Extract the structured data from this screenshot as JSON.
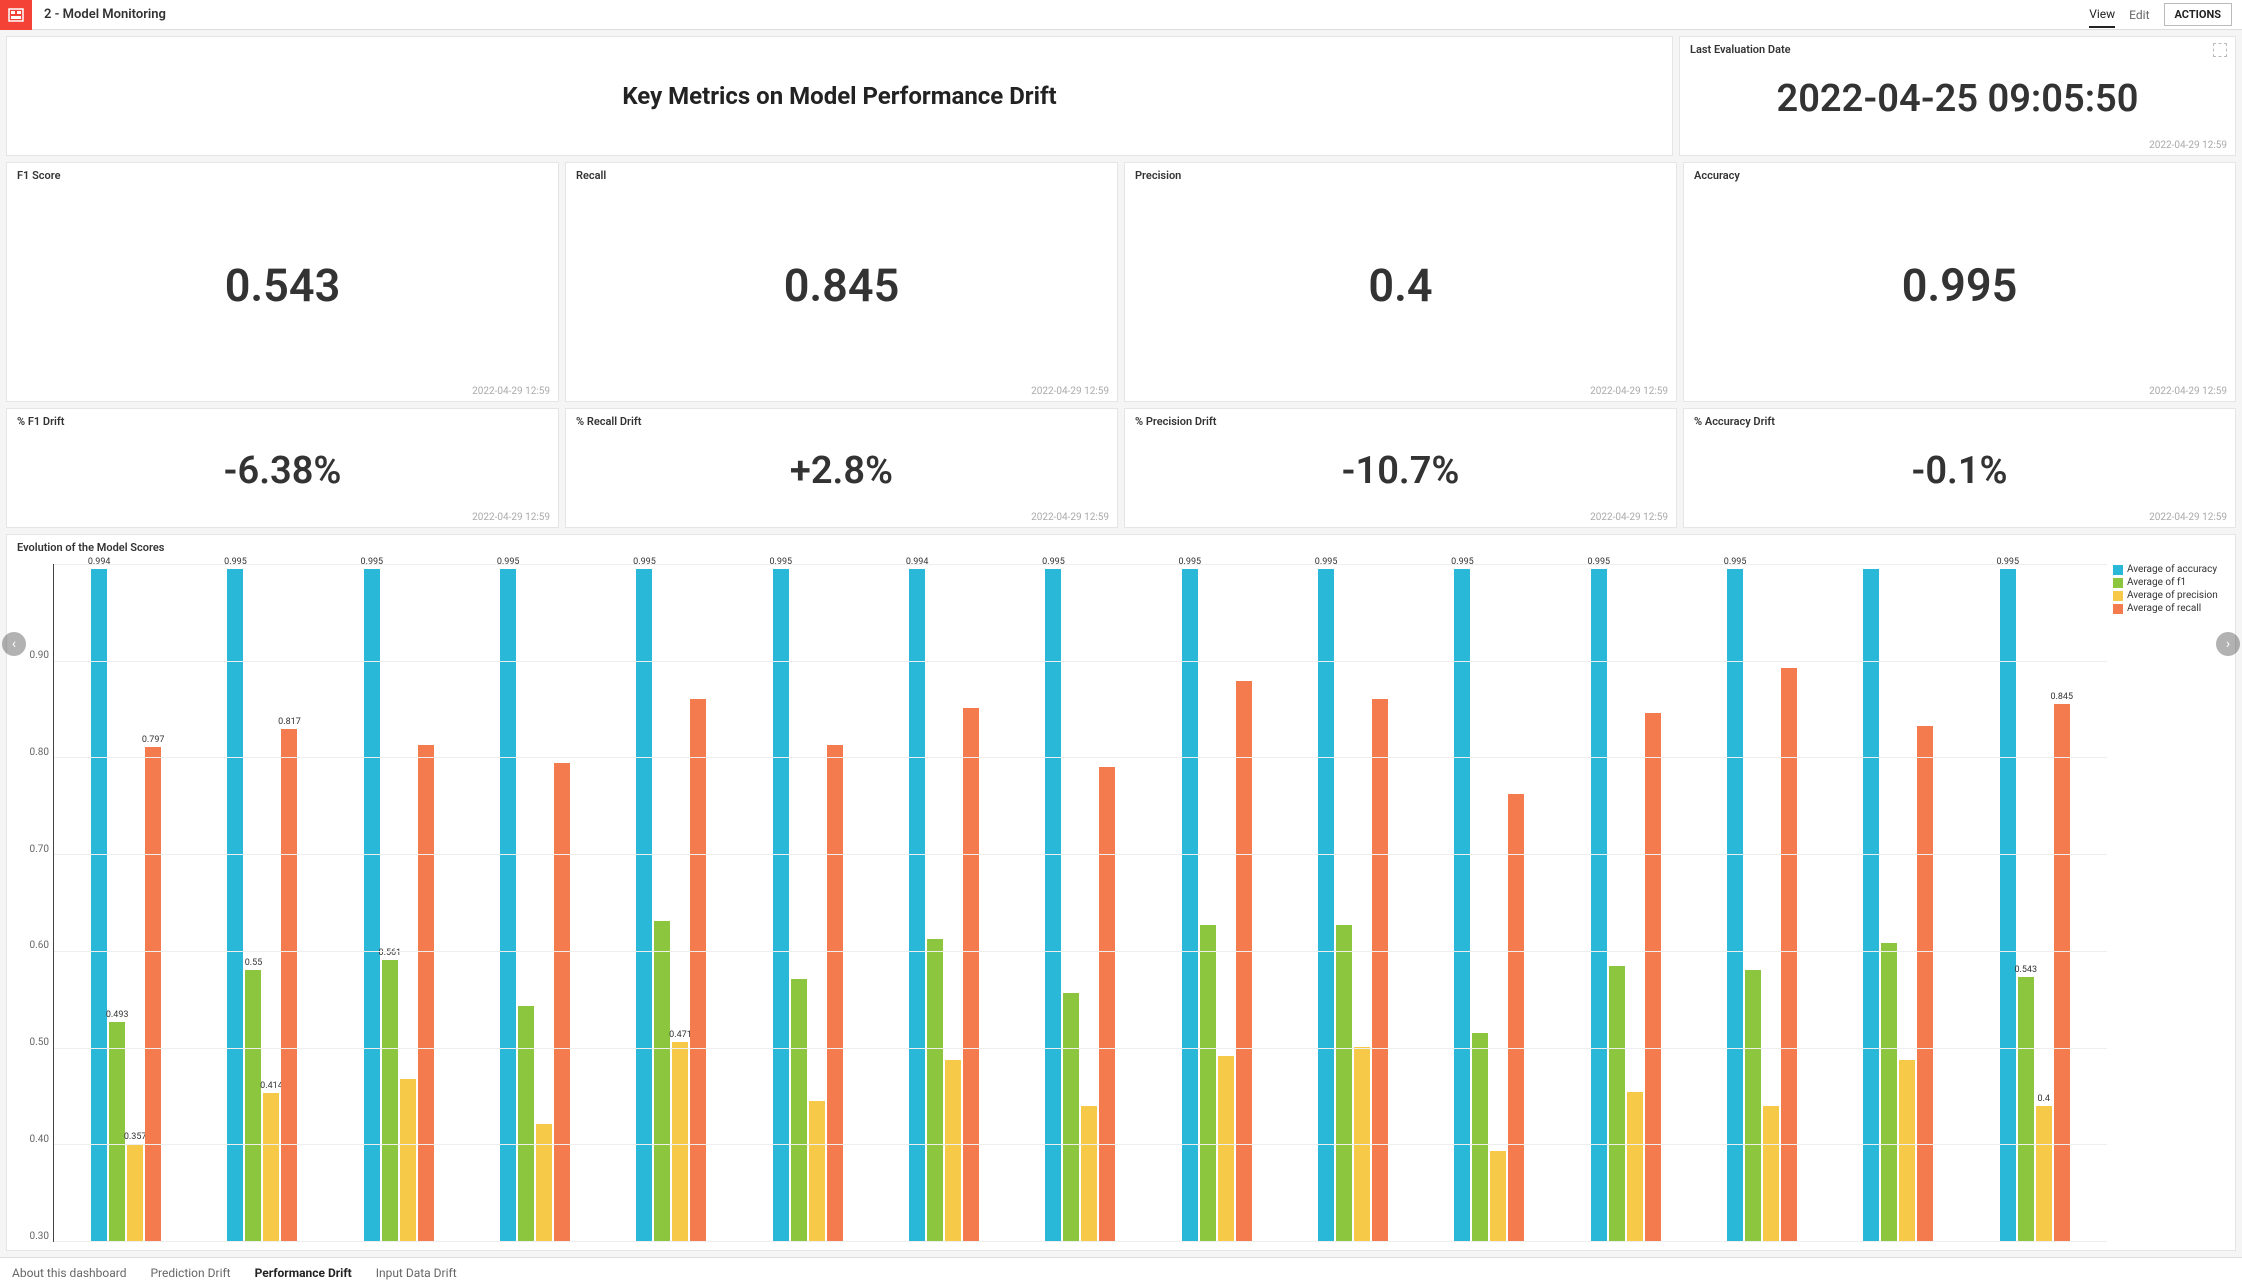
{
  "topbar": {
    "title": "2 - Model Monitoring",
    "view": "View",
    "edit": "Edit",
    "actions": "ACTIONS"
  },
  "hero": {
    "title": "Key Metrics on Model Performance Drift"
  },
  "evalDate": {
    "title": "Last Evaluation Date",
    "value": "2022-04-25 09:05:50",
    "footer": "2022-04-29 12:59"
  },
  "metrics": {
    "f1": {
      "title": "F1 Score",
      "value": "0.543",
      "footer": "2022-04-29 12:59"
    },
    "recall": {
      "title": "Recall",
      "value": "0.845",
      "footer": "2022-04-29 12:59"
    },
    "precision": {
      "title": "Precision",
      "value": "0.4",
      "footer": "2022-04-29 12:59"
    },
    "accuracy": {
      "title": "Accuracy",
      "value": "0.995",
      "footer": "2022-04-29 12:59"
    }
  },
  "drift": {
    "f1": {
      "title": "% F1 Drift",
      "value": "-6.38%",
      "footer": "2022-04-29 12:59"
    },
    "recall": {
      "title": "% Recall Drift",
      "value": "+2.8%",
      "footer": "2022-04-29 12:59"
    },
    "precision": {
      "title": "% Precision Drift",
      "value": "-10.7%",
      "footer": "2022-04-29 12:59"
    },
    "accuracy": {
      "title": "% Accuracy Drift",
      "value": "-0.1%",
      "footer": "2022-04-29 12:59"
    }
  },
  "chart": {
    "title": "Evolution of the Model Scores"
  },
  "chart_data": {
    "type": "bar",
    "title": "Evolution of the Model Scores",
    "ylim": [
      0,
      1
    ],
    "yticks": [
      "0.30",
      "0.40",
      "0.50",
      "0.60",
      "0.70",
      "0.80",
      "0.90",
      ""
    ],
    "series": [
      {
        "name": "Average of accuracy",
        "color": "#29b8d8"
      },
      {
        "name": "Average of f1",
        "color": "#8cc63f"
      },
      {
        "name": "Average of precision",
        "color": "#f7c948"
      },
      {
        "name": "Average of recall",
        "color": "#f47b4e"
      }
    ],
    "groups": [
      {
        "accuracy": 0.994,
        "f1": 0.493,
        "precision": 0.357,
        "recall": 0.797,
        "labels": {
          "accuracy": "0.994",
          "f1": "0.493",
          "precision": "0.357",
          "recall": "0.797"
        }
      },
      {
        "accuracy": 0.995,
        "f1": 0.55,
        "precision": 0.414,
        "recall": 0.817,
        "labels": {
          "accuracy": "0.995",
          "f1": "0.55",
          "precision": "0.414",
          "recall": "0.817"
        }
      },
      {
        "accuracy": 0.995,
        "f1": 0.561,
        "precision": 0.43,
        "recall": 0.8,
        "labels": {
          "accuracy": "0.995",
          "f1": "0.561"
        }
      },
      {
        "accuracy": 0.995,
        "f1": 0.51,
        "precision": 0.38,
        "recall": 0.78,
        "labels": {
          "accuracy": "0.995"
        }
      },
      {
        "accuracy": 0.995,
        "f1": 0.605,
        "precision": 0.471,
        "recall": 0.85,
        "labels": {
          "accuracy": "0.995",
          "precision": "0.471"
        }
      },
      {
        "accuracy": 0.995,
        "f1": 0.54,
        "precision": 0.405,
        "recall": 0.8,
        "labels": {
          "accuracy": "0.995"
        }
      },
      {
        "accuracy": 0.994,
        "f1": 0.585,
        "precision": 0.45,
        "recall": 0.84,
        "labels": {
          "accuracy": "0.994"
        }
      },
      {
        "accuracy": 0.995,
        "f1": 0.525,
        "precision": 0.4,
        "recall": 0.775,
        "labels": {
          "accuracy": "0.995"
        }
      },
      {
        "accuracy": 0.995,
        "f1": 0.6,
        "precision": 0.455,
        "recall": 0.87,
        "labels": {
          "accuracy": "0.995"
        }
      },
      {
        "accuracy": 0.995,
        "f1": 0.6,
        "precision": 0.465,
        "recall": 0.85,
        "labels": {
          "accuracy": "0.995"
        }
      },
      {
        "accuracy": 0.995,
        "f1": 0.48,
        "precision": 0.35,
        "recall": 0.745,
        "labels": {
          "accuracy": "0.995"
        }
      },
      {
        "accuracy": 0.995,
        "f1": 0.555,
        "precision": 0.415,
        "recall": 0.835,
        "labels": {
          "accuracy": "0.995"
        }
      },
      {
        "accuracy": 0.995,
        "f1": 0.55,
        "precision": 0.4,
        "recall": 0.885,
        "labels": {
          "accuracy": "0.995"
        }
      },
      {
        "accuracy": 0.995,
        "f1": 0.58,
        "precision": 0.45,
        "recall": 0.82,
        "labels": {}
      },
      {
        "accuracy": 0.995,
        "f1": 0.543,
        "precision": 0.4,
        "recall": 0.845,
        "labels": {
          "accuracy": "0.995",
          "f1": "0.543",
          "precision": "0.4",
          "recall": "0.845"
        }
      }
    ]
  },
  "tabs": {
    "about": "About this dashboard",
    "prediction": "Prediction Drift",
    "performance": "Performance Drift",
    "input": "Input Data Drift"
  }
}
